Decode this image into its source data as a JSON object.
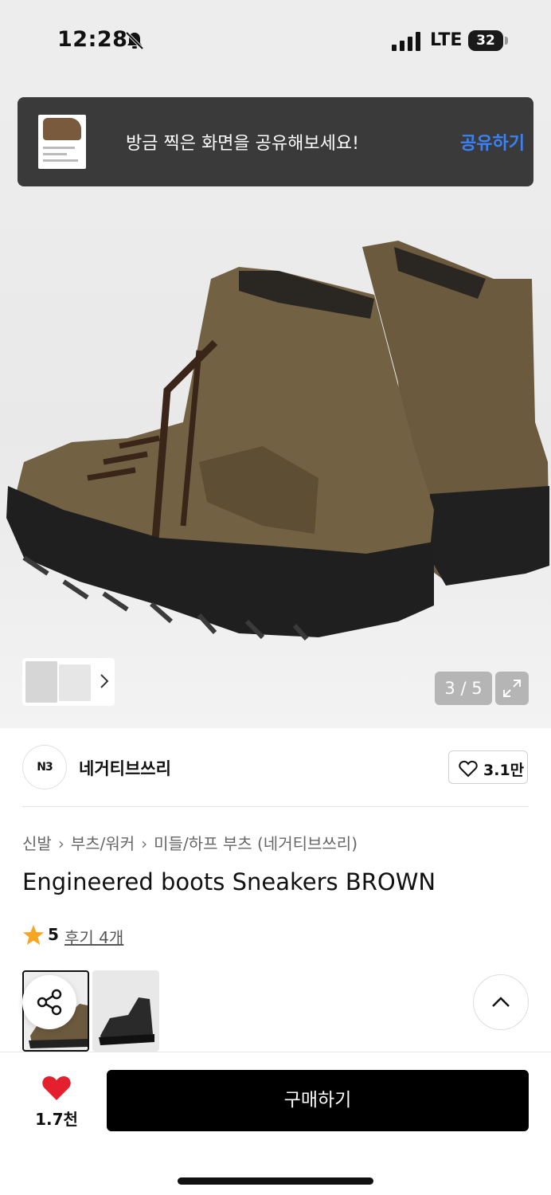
{
  "status_bar": {
    "time": "12:28",
    "network": "LTE",
    "battery": "32",
    "icons": [
      "bell-slash-icon",
      "signal-icon",
      "battery-icon"
    ]
  },
  "toast": {
    "message": "방금 찍은 화면을 공유해보세요!",
    "action": "공유하기"
  },
  "gallery": {
    "counter": "3 / 5",
    "icons": [
      "chevron-right-icon",
      "expand-icon"
    ]
  },
  "store": {
    "logo_text": "N3",
    "name": "네거티브쓰리",
    "like_count": "3.1만"
  },
  "breadcrumb": {
    "items": [
      "신발",
      "부츠/워커",
      "미들/하프 부츠 (네거티브쓰리)"
    ]
  },
  "product": {
    "title": "Engineered boots Sneakers BROWN",
    "rating": "5",
    "reviews": "후기 4개"
  },
  "options": {
    "icons": [
      "share-icon",
      "chevron-up-icon"
    ]
  },
  "bottom_bar": {
    "heart_count": "1.7천",
    "buy_label": "구매하기"
  },
  "colors": {
    "accent_blue": "#3b82f6",
    "heart_red": "#e5202e",
    "star_orange": "#f5a623",
    "boot_brown": "#6b5a3e"
  }
}
